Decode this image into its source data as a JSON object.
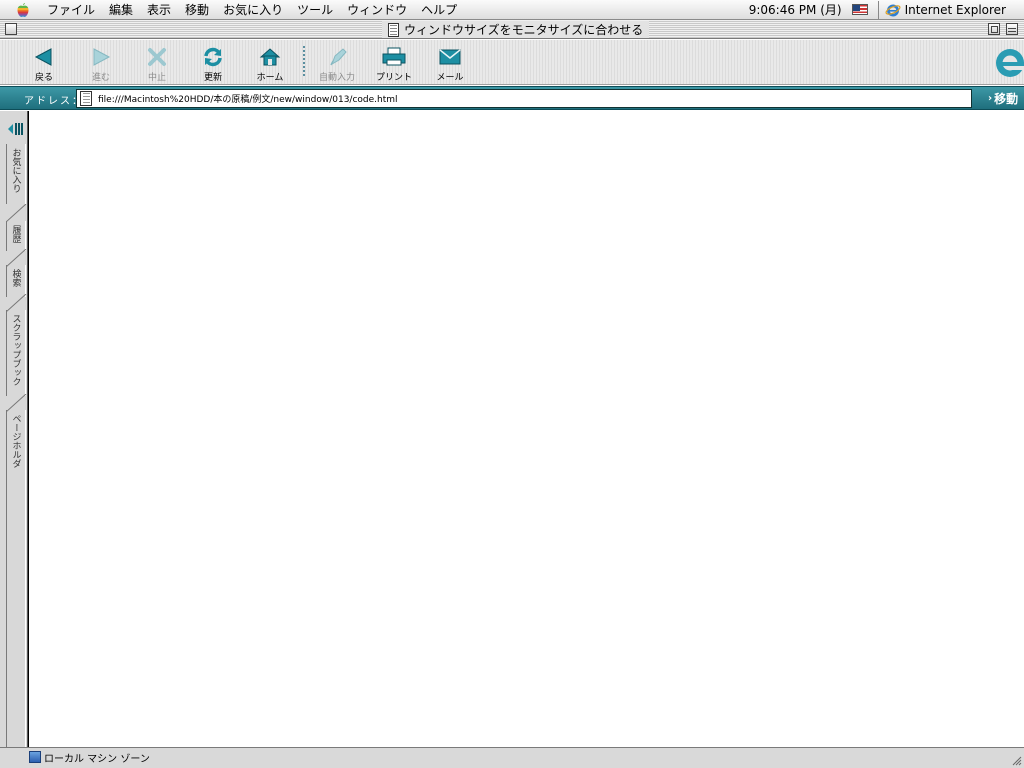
{
  "menubar": {
    "items": [
      "ファイル",
      "編集",
      "表示",
      "移動",
      "お気に入り",
      "ツール",
      "ウィンドウ",
      "ヘルプ"
    ],
    "clock": "9:06:46 PM (月)",
    "app_name": "Internet Explorer"
  },
  "window": {
    "title": "ウィンドウサイズをモニタサイズに合わせる"
  },
  "toolbar": {
    "buttons": [
      {
        "label": "戻る",
        "enabled": true
      },
      {
        "label": "進む",
        "enabled": false
      },
      {
        "label": "中止",
        "enabled": false
      },
      {
        "label": "更新",
        "enabled": true
      },
      {
        "label": "ホーム",
        "enabled": true
      },
      {
        "label": "自動入力",
        "enabled": false
      },
      {
        "label": "プリント",
        "enabled": true
      },
      {
        "label": "メール",
        "enabled": true
      }
    ]
  },
  "address": {
    "label": "アドレス：",
    "value": "file:///Macintosh%20HDD/本の原稿/例文/new/window/013/code.html",
    "go_label": "移動"
  },
  "explorer_tabs": [
    {
      "label": "お気に入り"
    },
    {
      "label": "履歴"
    },
    {
      "label": "検索"
    },
    {
      "label": "スクラップブック"
    },
    {
      "label": "ページホルダ"
    }
  ],
  "status": {
    "zone_text": "ローカル マシン ゾーン"
  },
  "colors": {
    "accent_teal": "#1f8a99",
    "address_bar": "#2b8593",
    "icon_disabled": "#9cc8d0"
  }
}
